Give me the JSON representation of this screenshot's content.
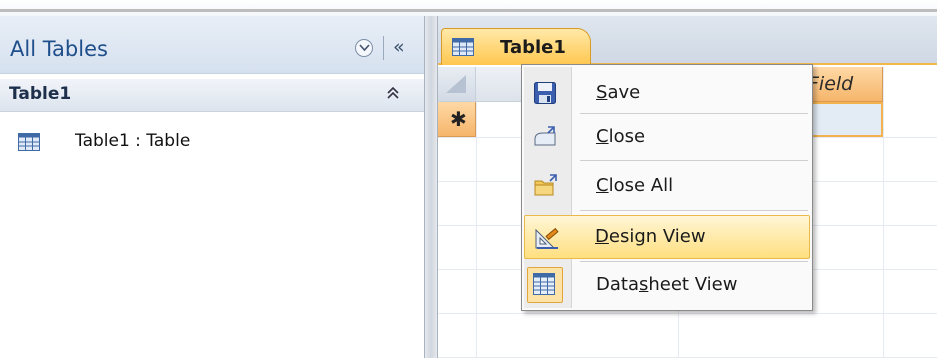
{
  "nav": {
    "title": "All Tables",
    "group_title": "Table1",
    "items": [
      {
        "label": "Table1 : Table",
        "icon": "table-icon"
      }
    ],
    "dropdown_icon": "chevron-down-circle-icon",
    "collapse_icon": "double-chevron-left-icon",
    "group_chevron_icon": "double-chevron-up-icon"
  },
  "document": {
    "tab_label": "Table1",
    "tab_icon": "table-icon",
    "column_header_partial": "Field",
    "new_record_marker": "✱"
  },
  "context_menu": {
    "items": [
      {
        "prefix": "",
        "accel": "S",
        "rest": "ave",
        "icon": "save-icon"
      },
      {
        "prefix": "",
        "accel": "C",
        "rest": "lose",
        "icon": "close-icon"
      },
      {
        "prefix": "",
        "accel": "C",
        "rest": "lose All",
        "icon": "close-all-icon"
      },
      {
        "prefix": "",
        "accel": "D",
        "rest": "esign View",
        "icon": "design-view-icon"
      },
      {
        "prefix": "Data",
        "accel": "s",
        "rest": "heet View",
        "icon": "datasheet-view-icon"
      }
    ]
  },
  "colors": {
    "accent_orange": "#f3b24e",
    "nav_title_blue": "#1f4f8a",
    "highlight_yellow": "#ffdf80"
  }
}
